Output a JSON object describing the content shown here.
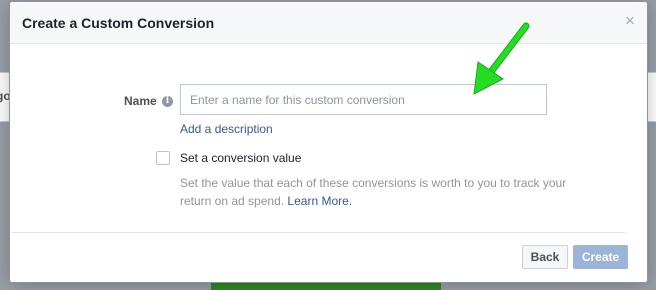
{
  "dialog": {
    "title": "Create a Custom Conversion",
    "close_symbol": "×"
  },
  "form": {
    "name_label": "Name",
    "info_symbol": "i",
    "name_placeholder": "Enter a name for this custom conversion",
    "name_value": "",
    "add_description": "Add a description",
    "conversion_value_label": "Set a conversion value",
    "conversion_value_checked": false,
    "conversion_value_help": "Set the value that each of these conversions is worth to you to track your return on ad spend.",
    "learn_more": "Learn More."
  },
  "footer": {
    "back_label": "Back",
    "create_label": "Create"
  },
  "colors": {
    "link": "#365899",
    "annotation_arrow": "#22dd22",
    "create_disabled": "#9cb4d8"
  },
  "icons": {
    "close": "close-icon",
    "info": "info-icon",
    "annotation": "arrow-annotation"
  }
}
